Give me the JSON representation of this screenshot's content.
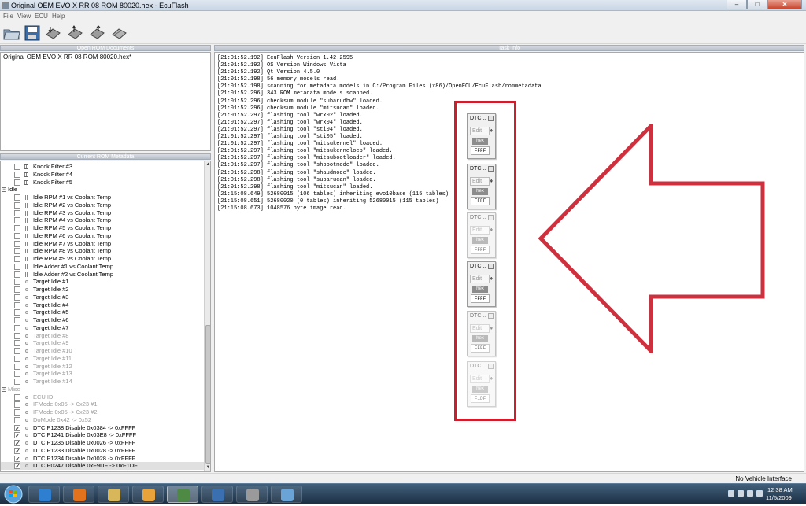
{
  "window": {
    "title": "Original OEM EVO X RR 08 ROM 80020.hex - EcuFlash",
    "min_glyph": "–",
    "max_glyph": "□",
    "close_glyph": "✕"
  },
  "menu": [
    "File",
    "View",
    "ECU",
    "Help"
  ],
  "toolbar_icons": [
    "open-folder-icon",
    "save-icon",
    "read-ecu-icon",
    "write-ecu-icon",
    "test-write-icon",
    "compare-icon"
  ],
  "panels": {
    "open_rom_documents": "Open ROM Documents",
    "current_rom_metadata": "Current ROM Metadata",
    "task_info": "Task Info"
  },
  "rom_documents": [
    "Original OEM EVO X RR 08 ROM 80020.hex*"
  ],
  "tree": [
    {
      "label": "Knock Filter #3",
      "icon": "grid"
    },
    {
      "label": "Knock Filter #4",
      "icon": "grid"
    },
    {
      "label": "Knock Filter #5",
      "icon": "grid"
    },
    {
      "label": "Idle",
      "group": true
    },
    {
      "label": "Idle RPM #1 vs Coolant Temp",
      "icon": "tbl"
    },
    {
      "label": "Idle RPM #2 vs Coolant Temp",
      "icon": "tbl"
    },
    {
      "label": "Idle RPM #3 vs Coolant Temp",
      "icon": "tbl"
    },
    {
      "label": "Idle RPM #4 vs Coolant Temp",
      "icon": "tbl"
    },
    {
      "label": "Idle RPM #5 vs Coolant Temp",
      "icon": "tbl"
    },
    {
      "label": "Idle RPM #6 vs Coolant Temp",
      "icon": "tbl"
    },
    {
      "label": "Idle RPM #7 vs Coolant Temp",
      "icon": "tbl"
    },
    {
      "label": "Idle RPM #8 vs Coolant Temp",
      "icon": "tbl"
    },
    {
      "label": "Idle RPM #9 vs Coolant Temp",
      "icon": "tbl"
    },
    {
      "label": "Idle Adder #1 vs Coolant Temp",
      "icon": "tbl"
    },
    {
      "label": "Idle Adder #2 vs Coolant Temp",
      "icon": "tbl"
    },
    {
      "label": "Target Idle #1",
      "icon": "mark"
    },
    {
      "label": "Target Idle #2",
      "icon": "mark"
    },
    {
      "label": "Target Idle #3",
      "icon": "mark"
    },
    {
      "label": "Target Idle #4",
      "icon": "mark"
    },
    {
      "label": "Target Idle #5",
      "icon": "mark"
    },
    {
      "label": "Target Idle #6",
      "icon": "mark"
    },
    {
      "label": "Target Idle #7",
      "icon": "mark"
    },
    {
      "label": "Target Idle #8",
      "icon": "mark",
      "fade": true
    },
    {
      "label": "Target Idle #9",
      "icon": "mark",
      "fade": true
    },
    {
      "label": "Target Idle #10",
      "icon": "mark",
      "fade": true
    },
    {
      "label": "Target Idle #11",
      "icon": "mark",
      "fade": true
    },
    {
      "label": "Target Idle #12",
      "icon": "mark",
      "fade": true
    },
    {
      "label": "Target Idle #13",
      "icon": "mark",
      "fade": true
    },
    {
      "label": "Target Idle #14",
      "icon": "mark",
      "fade": true
    },
    {
      "label": "Misc",
      "group": true,
      "fade": true
    },
    {
      "label": "ECU ID",
      "icon": "mark",
      "fade": true
    },
    {
      "label": "IFMode 0x05 -> 0x23 #1",
      "icon": "mark",
      "fade": true
    },
    {
      "label": "IFMode 0x05 -> 0x23 #2",
      "icon": "mark",
      "fade": true
    },
    {
      "label": "DoMode 0x42 -> 0x52",
      "icon": "mark",
      "fade": true
    },
    {
      "label": "DTC P1238 Disable 0x0384 -> 0xFFFF",
      "icon": "mark",
      "checked": true
    },
    {
      "label": "DTC P1241 Disable 0x03E8 -> 0xFFFF",
      "icon": "mark",
      "checked": true
    },
    {
      "label": "DTC P1235 Disable 0x0026 -> 0xFFFF",
      "icon": "mark",
      "checked": true
    },
    {
      "label": "DTC P1233 Disable 0x0028 -> 0xFFFF",
      "icon": "mark",
      "checked": true
    },
    {
      "label": "DTC P1234 Disable 0x0028 -> 0xFFFF",
      "icon": "mark",
      "checked": true
    },
    {
      "label": "DTC P0247 Disable 0xF9DF -> 0xF1DF",
      "icon": "mark",
      "checked": true,
      "selected": true
    }
  ],
  "scroll": {
    "up": "▲",
    "down": "▼"
  },
  "log": [
    "[21:01:52.192] EcuFlash Version 1.42.2595",
    "[21:01:52.192] OS Version Windows Vista",
    "[21:01:52.192] Qt Version 4.5.0",
    "[21:01:52.198] 56 memory models read.",
    "[21:01:52.198] scanning for metadata models in C:/Program Files (x86)/OpenECU/EcuFlash/rommetadata",
    "[21:01:52.296] 343 ROM metadata models scanned.",
    "[21:01:52.296] checksum module \"subarudbw\" loaded.",
    "[21:01:52.296] checksum module \"mitsucan\" loaded.",
    "[21:01:52.297] flashing tool \"wrx02\" loaded.",
    "[21:01:52.297] flashing tool \"wrx04\" loaded.",
    "[21:01:52.297] flashing tool \"sti04\" loaded.",
    "[21:01:52.297] flashing tool \"sti05\" loaded.",
    "[21:01:52.297] flashing tool \"mitsukernel\" loaded.",
    "[21:01:52.297] flashing tool \"mitsukernelocp\" loaded.",
    "[21:01:52.297] flashing tool \"mitsubootloader\" loaded.",
    "[21:01:52.297] flashing tool \"shbootmode\" loaded.",
    "[21:01:52.298] flashing tool \"shaudmode\" loaded.",
    "[21:01:52.298] flashing tool \"subarucan\" loaded.",
    "[21:01:52.298] flashing tool \"mitsucan\" loaded.",
    "[21:15:08.649] 52680015 (106 tables) inheriting evo10base (115 tables)",
    "[21:15:08.651] 52680020 (0 tables) inheriting 52680015 (115 tables)",
    "[21:15:08.673] 1048576 byte image read."
  ],
  "dtc_windows": [
    {
      "title": "DTC...",
      "edit": "Edit",
      "hex": "hex",
      "value": "FFFF",
      "chevron": "»"
    },
    {
      "title": "DTC...",
      "edit": "Edit",
      "hex": "hex",
      "value": "FFFF",
      "chevron": "»"
    },
    {
      "title": "DTC...",
      "edit": "Edit",
      "hex": "hex",
      "value": "FFFF",
      "chevron": "»"
    },
    {
      "title": "DTC...",
      "edit": "Edit",
      "hex": "hex",
      "value": "FFFF",
      "chevron": "»"
    },
    {
      "title": "DTC...",
      "edit": "Edit",
      "hex": "hex",
      "value": "FFFF",
      "chevron": "»"
    },
    {
      "title": "DTC...",
      "edit": "Edit",
      "hex": "hex",
      "value": "F1DF",
      "chevron": "»"
    }
  ],
  "annotation_color": "#cc1f2e",
  "status": "No Vehicle Interface",
  "taskbar": {
    "items": [
      "internet-explorer-icon",
      "firefox-icon",
      "explorer-icon",
      "media-player-icon",
      "ecuflash-icon",
      "itunes-icon",
      "paint-icon",
      "notepad-icon"
    ],
    "time": "12:38 AM",
    "date": "11/5/2009"
  }
}
